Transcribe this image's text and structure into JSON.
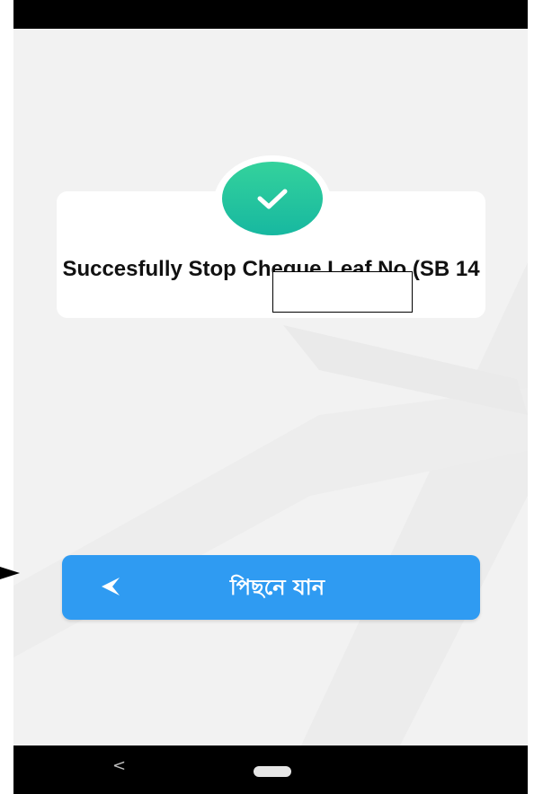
{
  "dialog": {
    "message": "Succesfully Stop Cheque Leaf No (SB 14",
    "icon": "check-circle-icon"
  },
  "actions": {
    "back_label": "পিছনে যান",
    "back_icon": "back-arrow-icon"
  },
  "system_nav": {
    "back_glyph": "<",
    "home_icon": "home-pill-icon"
  },
  "colors": {
    "accent_button": "#2f9bf2",
    "success_start": "#34d29c",
    "success_end": "#17b8a0",
    "background": "#f2f2f2"
  }
}
